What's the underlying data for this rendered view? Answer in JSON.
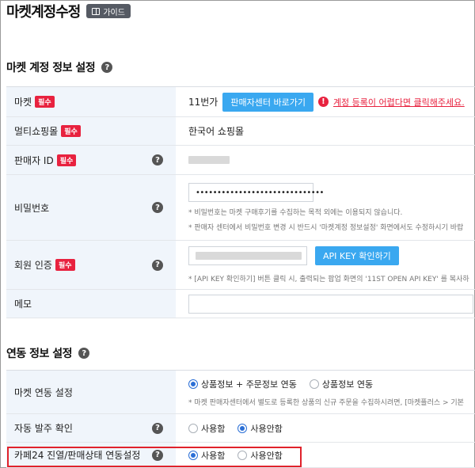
{
  "page": {
    "title": "마켓계정수정",
    "guide_label": "가이드"
  },
  "market_section": {
    "title": "마켓 계정 정보 설정",
    "rows": {
      "market": {
        "label": "마켓",
        "required": "필수",
        "value": "11번가",
        "button": "판매자센터 바로가기",
        "warning": "계정 등록이 어렵다면 클릭해주세요."
      },
      "multi_mall": {
        "label": "멀티쇼핑몰",
        "required": "필수",
        "value": "한국어 쇼핑몰"
      },
      "seller_id": {
        "label": "판매자 ID",
        "required": "필수"
      },
      "password": {
        "label": "비밀번호",
        "value": "••••••••••••••••••••••••••••••",
        "note1": "* 비밀번호는 마켓 구매후기를 수집하는 목적 외에는 이용되지 않습니다.",
        "note2": "* 판매자 센터에서 비밀번호 변경 시 반드시 '마켓계정 정보설정' 화면에서도 수정하시기 바랍"
      },
      "auth": {
        "label": "회원 인증",
        "required": "필수",
        "button": "API KEY 확인하기",
        "note": "* [API KEY 확인하기] 버튼 클릭 시, 출력되는 팝업 화면의 '11ST OPEN API KEY' 를 복사하"
      },
      "memo": {
        "label": "메모"
      }
    }
  },
  "link_section": {
    "title": "연동 정보 설정",
    "rows": {
      "market_link": {
        "label": "마켓 연동 설정",
        "option1": "상품정보 + 주문정보 연동",
        "option2": "상품정보 연동",
        "selected": 1,
        "note": "* 마켓 판매자센터에서 별도로 등록한 상품의 신규 주문을 수집하시려면, [마켓플러스 > 기본 "
      },
      "auto_order": {
        "label": "자동 발주 확인",
        "option1": "사용함",
        "option2": "사용안함",
        "selected": 2
      },
      "cafe24_sync": {
        "label": "카페24 진열/판매상태 연동설정",
        "option1": "사용함",
        "option2": "사용안함",
        "selected": 1
      }
    }
  },
  "icons": {
    "help": "question-circle-icon",
    "warning": "exclamation-circle-icon",
    "guide": "book-icon"
  },
  "colors": {
    "required_badge": "#e8223f",
    "primary_button": "#3aa8f0",
    "label_bg": "#f0f5fb",
    "highlight_box": "#e0222b"
  }
}
